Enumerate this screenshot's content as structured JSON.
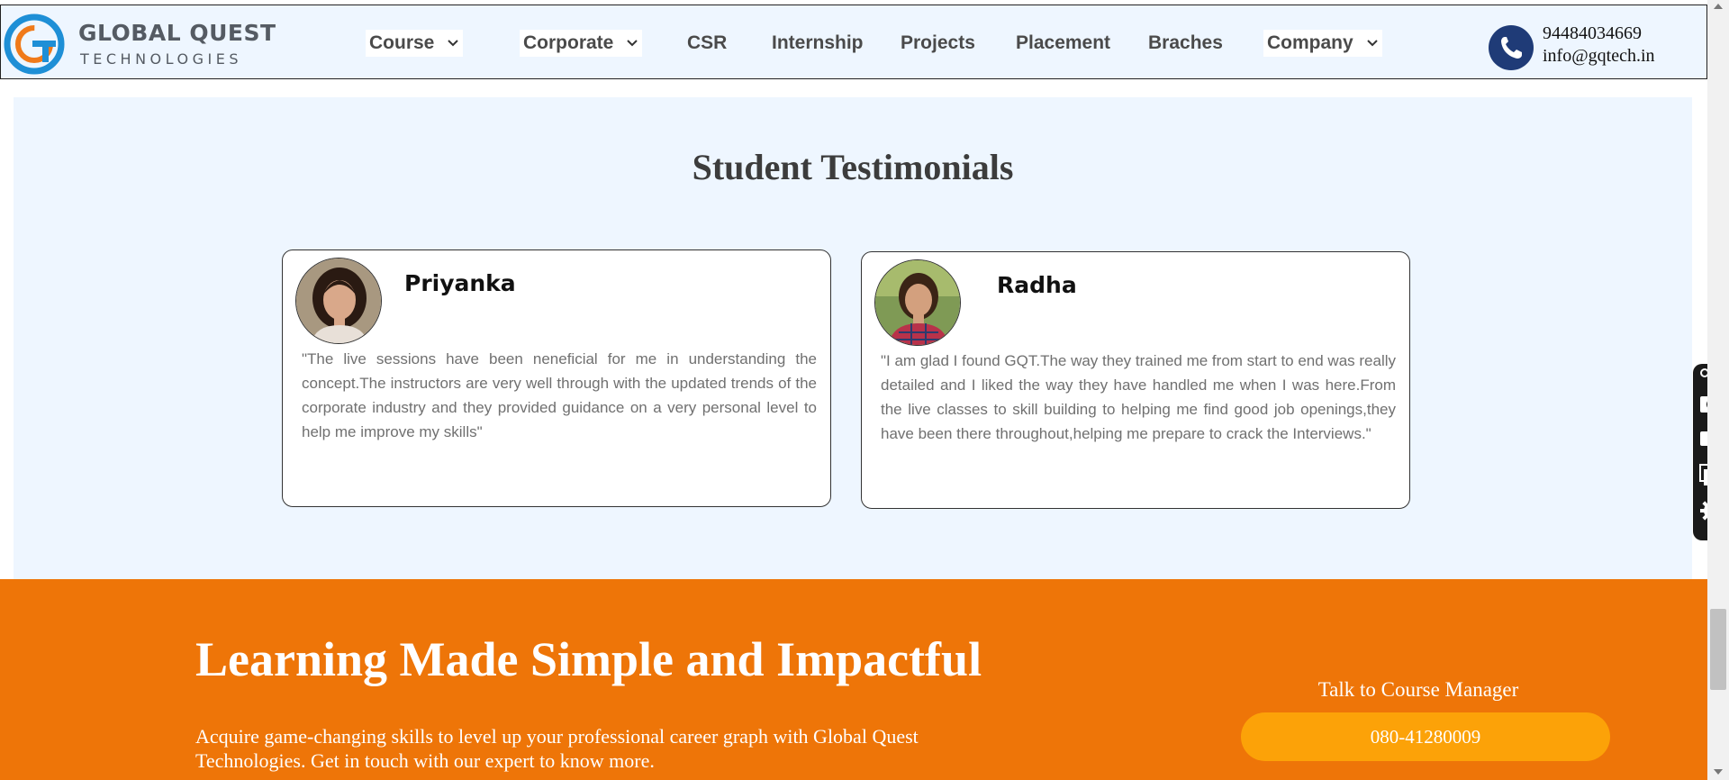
{
  "header": {
    "logo_line1": "GLOBAL QUEST",
    "logo_line2": "TECHNOLOGIES",
    "nav": {
      "course": "Course",
      "corporate": "Corporate",
      "csr": "CSR",
      "internship": "Internship",
      "projects": "Projects",
      "placement": "Placement",
      "braches": "Braches",
      "company": "Company"
    },
    "phone": "94484034669",
    "email": "info@gqtech.in"
  },
  "testimonials": {
    "title": "Student Testimonials",
    "items": [
      {
        "name": "Priyanka",
        "quote": "\"The live sessions have been neneficial for me in understanding the concept.The instructors are very well through with the updated trends of the corporate industry and they provided guidance on a very personal level to help me improve my skills\""
      },
      {
        "name": "Radha",
        "quote": "\"I am glad I found GQT.The way they trained me from start to end was really detailed and I liked the way they have handled me when I was here.From the live classes to skill building to helping me find good job openings,they have been there throughout,helping me prepare to crack the Interviews.\""
      }
    ]
  },
  "banner": {
    "title": "Learning Made Simple and Impactful",
    "subtitle": "Acquire game-changing skills to level up your professional career graph with Global Quest Technologies. Get in touch with our expert to know more.",
    "talk_label": "Talk to Course Manager",
    "talk_phone": "080-41280009"
  },
  "toolbar": {
    "icons": [
      "link-icon",
      "camera-icon",
      "video-icon",
      "windows-icon",
      "gear-icon"
    ]
  },
  "colors": {
    "header_bg": "#eef6ff",
    "section_bg": "#eef6ff",
    "banner_orange": "#ee7508",
    "button_orange": "#fca208",
    "phone_navy": "#1f3b77",
    "logo_blue": "#1e8fd6",
    "logo_orange": "#f07a1a"
  }
}
